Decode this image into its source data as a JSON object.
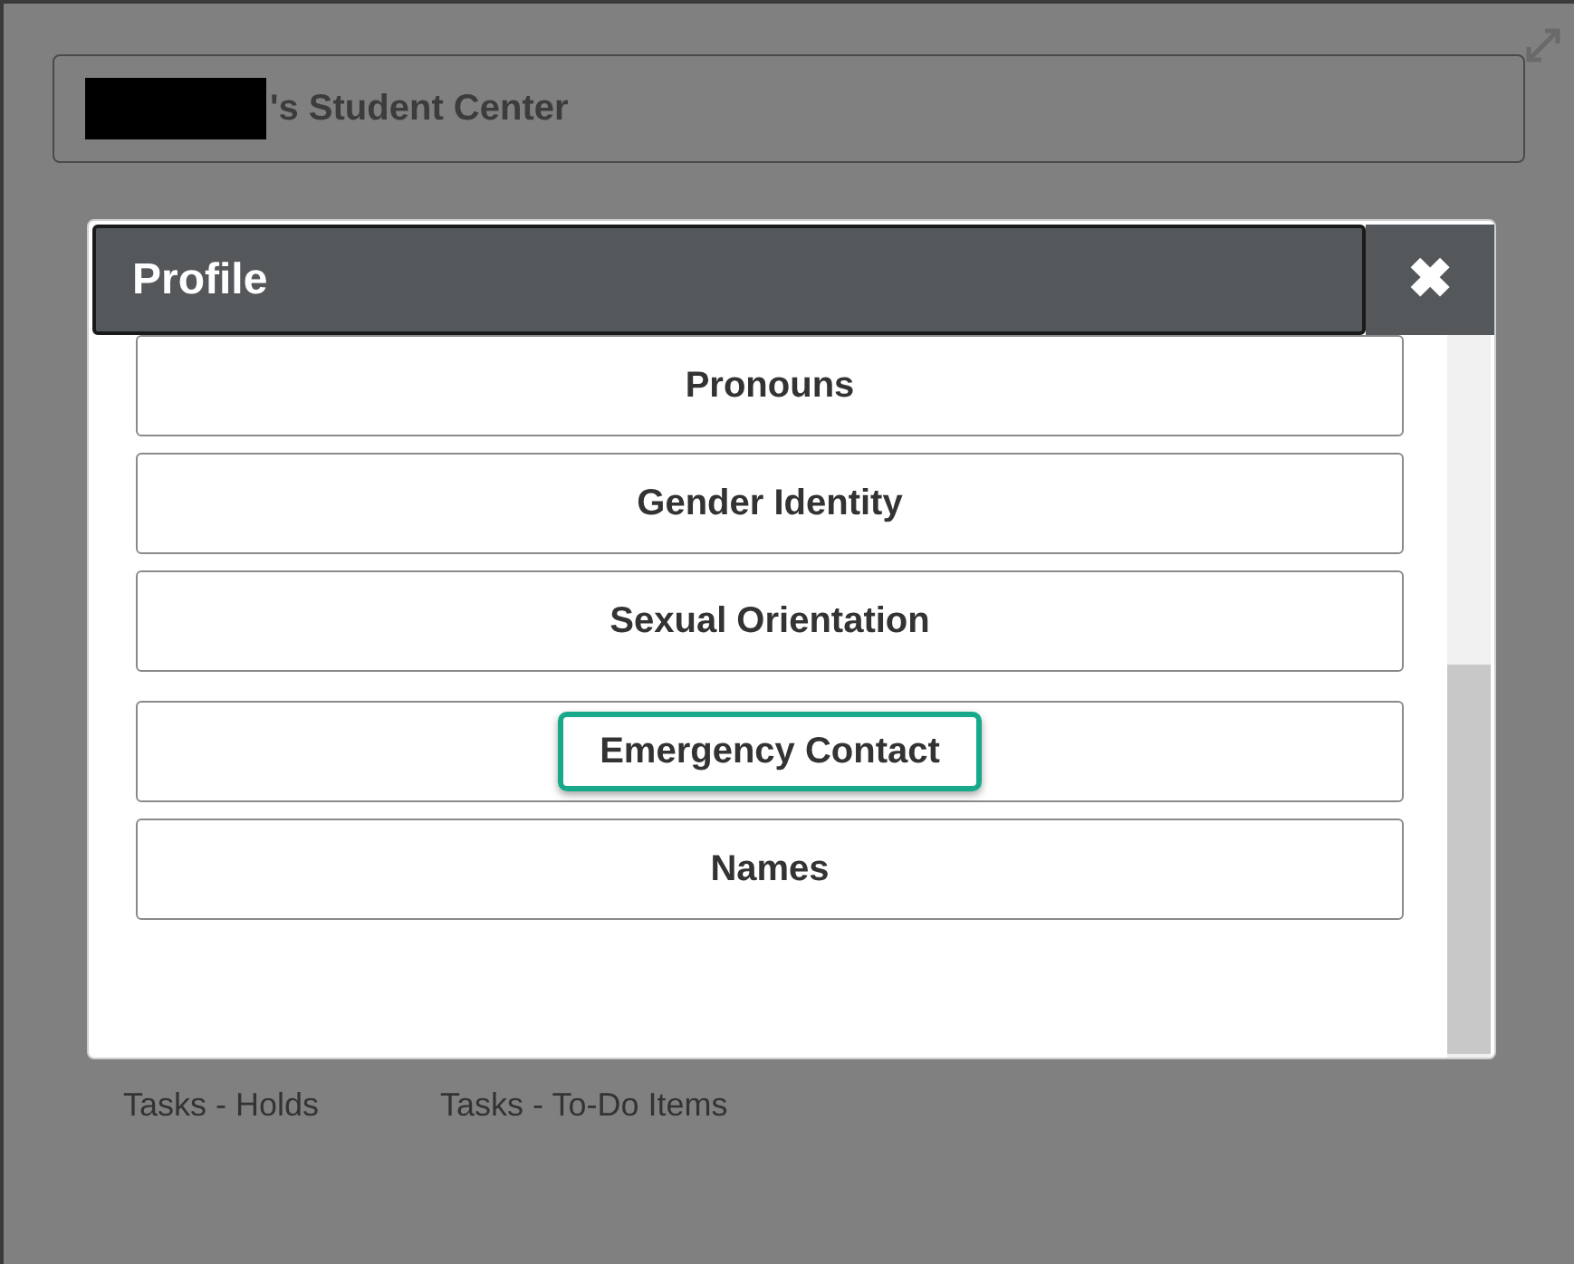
{
  "page": {
    "title": "'s Student Center"
  },
  "dialog": {
    "title": "Profile",
    "close_label": "✖",
    "items": [
      {
        "label": "Pronouns",
        "highlighted": false
      },
      {
        "label": "Gender Identity",
        "highlighted": false
      },
      {
        "label": "Sexual Orientation",
        "highlighted": false
      },
      {
        "label": "Emergency Contact",
        "highlighted": true
      },
      {
        "label": "Names",
        "highlighted": false
      }
    ]
  },
  "links": [
    "Tasks - Holds",
    "Tasks - To-Do Items"
  ]
}
